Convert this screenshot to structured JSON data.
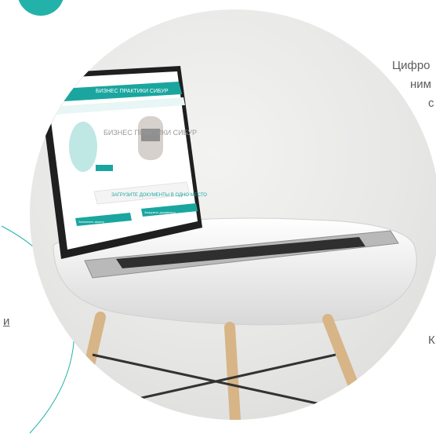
{
  "side_text": {
    "right_line_1": "Цифро",
    "right_line_2": "ним",
    "right_line_3": "с",
    "right_bottom": "К",
    "left_link_fragment": "и"
  },
  "laptop_screen": {
    "site_title": "БИЗНЕС ПРАКТИКИ СИБУР",
    "hero_text": "БИЗНЕС ПРАКТИКИ СИБУР",
    "banner_text": "ЗАГРУЗИТЕ ДОКУМЕНТЫ В ОДНО МЕСТО",
    "button_left": "Заполнить анкету",
    "button_right": "Загрузить документы"
  },
  "colors": {
    "accent": "#22b2aa",
    "text_muted": "#5c5c5c"
  }
}
